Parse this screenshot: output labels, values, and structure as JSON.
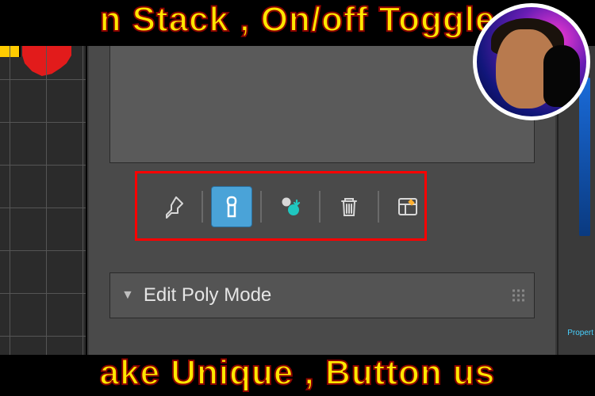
{
  "title_top": "n Stack , On/off Toggle",
  "title_bottom": "ake Unique , Button us",
  "toolbar": {
    "pin_name": "pin-stack-icon",
    "toggle_name": "show-end-result-toggle-icon",
    "unique_name": "make-unique-icon",
    "remove_name": "remove-modifier-icon",
    "config_name": "configure-modifier-sets-icon"
  },
  "rollup": {
    "label": "Edit Poly Mode",
    "expanded": true
  },
  "right_strip": {
    "label": "Propert"
  }
}
